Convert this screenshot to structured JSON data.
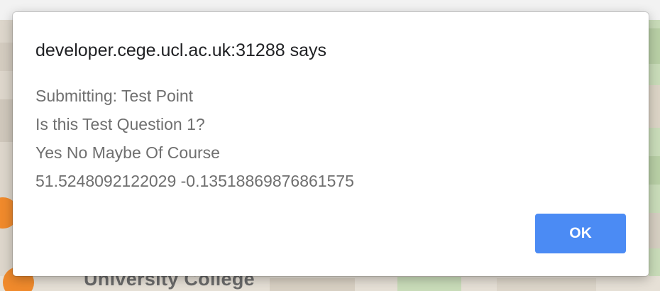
{
  "dialog": {
    "title": "developer.cege.ucl.ac.uk:31288 says",
    "message_lines": [
      "Submitting: Test Point",
      "Is this Test Question 1?",
      "Yes No Maybe Of Course",
      "51.5248092122029 -0.13518869876861575"
    ],
    "ok_label": "OK"
  },
  "map": {
    "label": "University College"
  },
  "colors": {
    "button_accent": "#4b8bf4",
    "marker_orange": "#f08a2c",
    "map_green": "#c9dcb9"
  }
}
